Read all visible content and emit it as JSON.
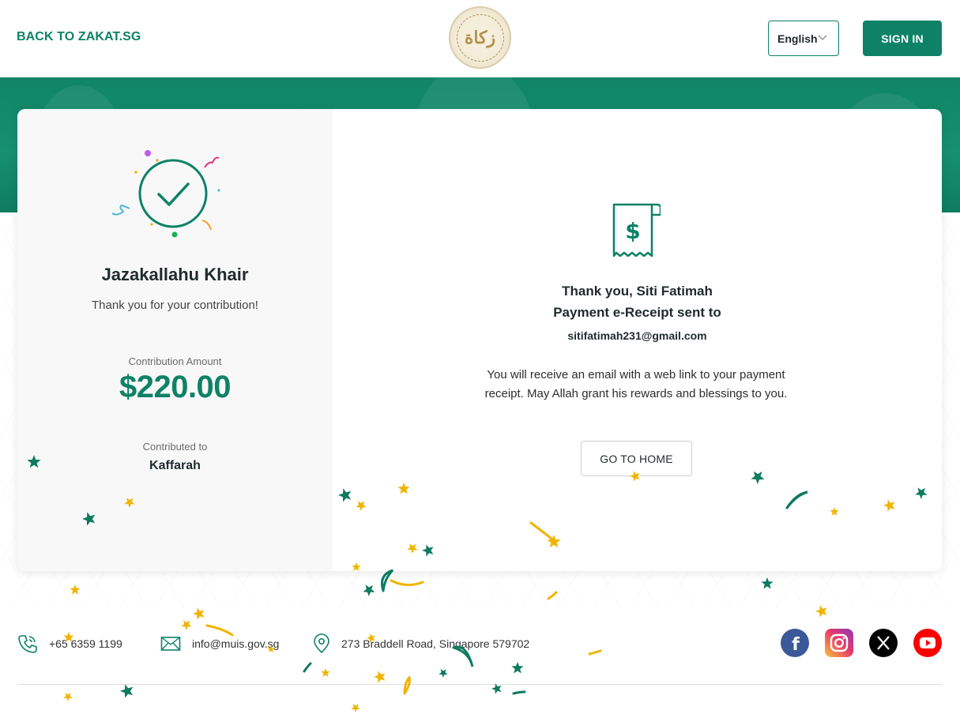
{
  "header": {
    "back_label": "BACK TO ZAKAT.SG",
    "language": "English",
    "signin_label": "SIGN IN",
    "logo_text": "زكاة"
  },
  "summary": {
    "title": "Jazakallahu Khair",
    "subtitle": "Thank you for your contribution!",
    "amount_label": "Contribution Amount",
    "amount_value": "$220.00",
    "contributed_label": "Contributed to",
    "contributed_value": "Kaffarah"
  },
  "receipt": {
    "thank_you": "Thank you, Siti Fatimah",
    "sent_to": "Payment e-Receipt sent to",
    "email": "sitifatimah231@gmail.com",
    "info": "You will receive an email with a web link to your payment receipt. May Allah grant his rewards and blessings to you.",
    "home_button": "GO TO HOME"
  },
  "footer": {
    "phone": "+65 6359 1199",
    "email": "info@muis.gov.sg",
    "address": "273 Braddell Road, Singapore 579702",
    "social": [
      "facebook-icon",
      "instagram-icon",
      "x-icon",
      "youtube-icon"
    ]
  },
  "colors": {
    "brand": "#0e8266",
    "confetti_green": "#0e7a5e",
    "confetti_gold": "#f0b400"
  }
}
